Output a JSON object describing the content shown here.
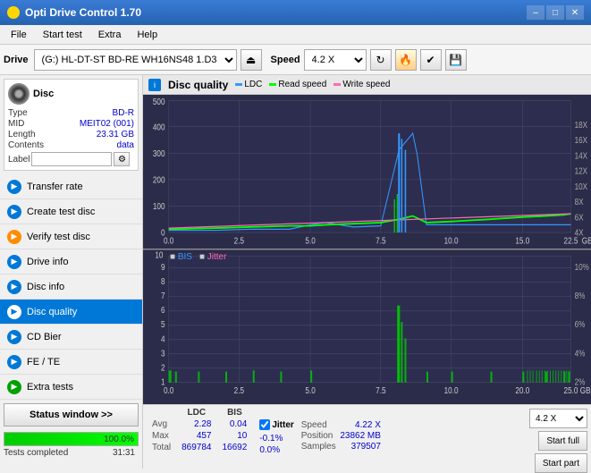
{
  "titlebar": {
    "title": "Opti Drive Control 1.70",
    "minimize": "–",
    "maximize": "□",
    "close": "✕"
  },
  "menubar": {
    "items": [
      "File",
      "Start test",
      "Extra",
      "Help"
    ]
  },
  "toolbar": {
    "drive_label": "Drive",
    "drive_value": "(G:) HL-DT-ST BD-RE  WH16NS48 1.D3",
    "speed_label": "Speed",
    "speed_value": "4.2 X"
  },
  "disc": {
    "header": "Disc",
    "type_label": "Type",
    "type_val": "BD-R",
    "mid_label": "MID",
    "mid_val": "MEIT02 (001)",
    "length_label": "Length",
    "length_val": "23.31 GB",
    "contents_label": "Contents",
    "contents_val": "data",
    "label_label": "Label",
    "label_placeholder": ""
  },
  "nav": {
    "items": [
      {
        "id": "transfer-rate",
        "label": "Transfer rate",
        "icon": "►",
        "color": "blue"
      },
      {
        "id": "create-test-disc",
        "label": "Create test disc",
        "icon": "►",
        "color": "blue"
      },
      {
        "id": "verify-test-disc",
        "label": "Verify test disc",
        "icon": "►",
        "color": "orange"
      },
      {
        "id": "drive-info",
        "label": "Drive info",
        "icon": "►",
        "color": "blue"
      },
      {
        "id": "disc-info",
        "label": "Disc info",
        "icon": "►",
        "color": "blue"
      },
      {
        "id": "disc-quality",
        "label": "Disc quality",
        "icon": "►",
        "color": "active",
        "active": true
      },
      {
        "id": "cd-bier",
        "label": "CD Bier",
        "icon": "►",
        "color": "blue"
      },
      {
        "id": "fe-te",
        "label": "FE / TE",
        "icon": "►",
        "color": "blue"
      },
      {
        "id": "extra-tests",
        "label": "Extra tests",
        "icon": "►",
        "color": "blue"
      }
    ]
  },
  "chart": {
    "title": "Disc quality",
    "icon": "i",
    "legend": {
      "ldc": "LDC",
      "read": "Read speed",
      "write": "Write speed",
      "bis": "BIS",
      "jitter": "Jitter"
    }
  },
  "stats": {
    "col_headers": [
      "LDC",
      "BIS",
      "",
      "Jitter",
      "Speed"
    ],
    "rows": [
      {
        "label": "Avg",
        "ldc": "2.28",
        "bis": "0.04",
        "jitter": "-0.1%",
        "speed": "4.22 X"
      },
      {
        "label": "Max",
        "ldc": "457",
        "bis": "10",
        "jitter": "0.0%",
        "speed_label": "Position",
        "speed": "23862 MB"
      },
      {
        "label": "Total",
        "ldc": "869784",
        "bis": "16692",
        "jitter": "",
        "speed_label2": "Samples",
        "speed2": "379507"
      }
    ]
  },
  "buttons": {
    "status_window": "Status window >>",
    "start_full": "Start full",
    "start_part": "Start part",
    "speed_combo": "4.2 X"
  },
  "statusbar": {
    "completed_text": "Tests completed",
    "progress": 100,
    "time": "31:31"
  }
}
